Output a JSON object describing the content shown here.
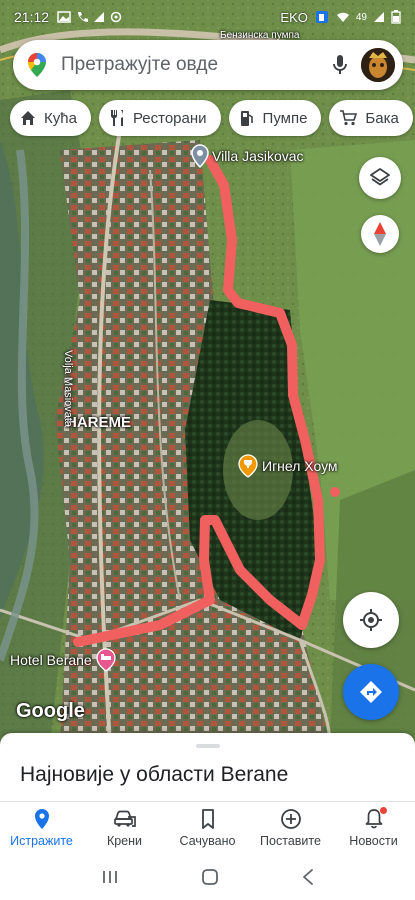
{
  "status_bar": {
    "time": "21:12",
    "station_label": "EKO",
    "notification_count": "49"
  },
  "search": {
    "placeholder": "Претражујте овде",
    "icon": "google-maps-pin-icon",
    "voice_icon": "mic-icon"
  },
  "chips": [
    {
      "label": "Кућа",
      "icon": "home-icon"
    },
    {
      "label": "Ресторани",
      "icon": "fork-knife-icon"
    },
    {
      "label": "Пумпе",
      "icon": "gas-pump-icon"
    },
    {
      "label": "Бака",
      "icon": "cart-icon"
    }
  ],
  "map": {
    "labels": {
      "villa": "Villa Jasikovac",
      "ignel": "Игнел Хоум",
      "hareme": "HAREME",
      "street": "Volja Masiovata",
      "hotel": "Hotel Berane",
      "gas_station": "Бензинска пумпа"
    },
    "attribution": "Google",
    "route_color": "#f0605e",
    "colors": {
      "forest": "#1f3a1c",
      "field": "#6f8f4b",
      "river": "#5f7a74",
      "accent": "#1a73e8"
    }
  },
  "sheet": {
    "title": "Најновије у области Berane"
  },
  "bottom_nav": [
    {
      "label": "Истражите",
      "icon": "location-pin-icon",
      "active": true
    },
    {
      "label": "Крени",
      "icon": "car-icon",
      "active": false
    },
    {
      "label": "Сачувано",
      "icon": "bookmark-icon",
      "active": false
    },
    {
      "label": "Поставите",
      "icon": "add-circle-icon",
      "active": false
    },
    {
      "label": "Новости",
      "icon": "bell-icon",
      "active": false
    }
  ]
}
